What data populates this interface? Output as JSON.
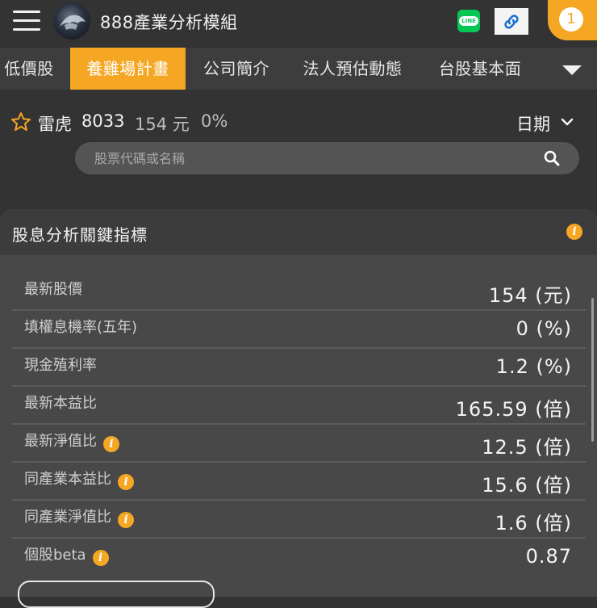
{
  "header": {
    "app_title": "888產業分析模組",
    "line_label": "LINE",
    "notification_count": "1",
    "accent_color": "#f5a623"
  },
  "tabs": [
    {
      "label": "低價股",
      "active": false
    },
    {
      "label": "養雞場計畫",
      "active": true
    },
    {
      "label": "公司簡介",
      "active": false
    },
    {
      "label": "法人預估動態",
      "active": false
    },
    {
      "label": "台股基本面",
      "active": false
    }
  ],
  "stock": {
    "name": "雷虎",
    "code": "8033",
    "price": "154 元",
    "change": "0%",
    "date_label": "日期"
  },
  "search": {
    "placeholder": "股票代碼或名稱"
  },
  "card": {
    "title": "股息分析關鍵指標",
    "metrics": [
      {
        "label": "最新股價",
        "value": "154 (元)",
        "has_info": false
      },
      {
        "label": "填權息機率(五年)",
        "value": "0 (%)",
        "has_info": false
      },
      {
        "label": "現金殖利率",
        "value": "1.2 (%)",
        "has_info": false
      },
      {
        "label": "最新本益比",
        "value": "165.59 (倍)",
        "has_info": false
      },
      {
        "label": "最新淨值比",
        "value": "12.5 (倍)",
        "has_info": true
      },
      {
        "label": "同產業本益比",
        "value": "15.6 (倍)",
        "has_info": true
      },
      {
        "label": "同產業淨值比",
        "value": "1.6 (倍)",
        "has_info": true
      },
      {
        "label": "個股beta",
        "value": "0.87",
        "has_info": true
      }
    ]
  }
}
